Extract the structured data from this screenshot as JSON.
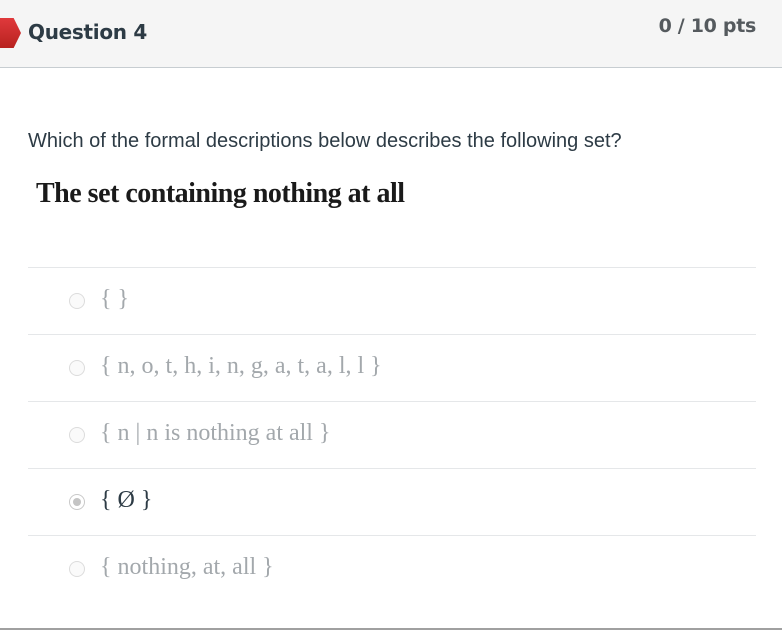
{
  "header": {
    "question_title": "Question 4",
    "points": "0 / 10 pts",
    "status_color": "#d32f2f"
  },
  "question": {
    "prompt": "Which of the formal descriptions below describes the following set?",
    "set_description": "The set containing nothing at all"
  },
  "answers": [
    {
      "label": "{ }",
      "selected": false
    },
    {
      "label": "{ n, o, t, h, i, n, g, a, t, a, l, l }",
      "selected": false
    },
    {
      "label": "{ n | n is nothing at all }",
      "selected": false
    },
    {
      "label": "{ Ø }",
      "selected": true
    },
    {
      "label": "{ nothing, at, all }",
      "selected": false
    }
  ]
}
